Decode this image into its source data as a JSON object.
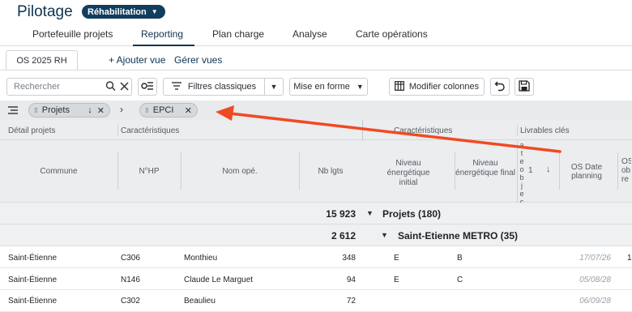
{
  "header": {
    "title": "Pilotage",
    "badge": "Réhabilitation",
    "tabs": [
      "Portefeuille projets",
      "Reporting",
      "Plan charge",
      "Analyse",
      "Carte opérations"
    ],
    "active_tab": "Reporting"
  },
  "views": {
    "current": "OS 2025 RH",
    "add_view": "+ Ajouter vue",
    "manage_views": "Gérer vues"
  },
  "toolbar": {
    "search_placeholder": "Rechercher",
    "filters_label": "Filtres classiques",
    "format_label": "Mise en forme",
    "modify_columns_label": "Modifier colonnes"
  },
  "grouping": {
    "chips": [
      "Projets",
      "EPCI"
    ]
  },
  "table": {
    "group_headers": {
      "detail": "Détail projets",
      "caracteristiques1": "Caractéristiques",
      "caracteristiques2": "Caractéristiques",
      "livrables": "Livrables clés"
    },
    "columns": {
      "commune": "Commune",
      "nhp": "N°HP",
      "nom": "Nom opé.",
      "nb_lgts": "Nb lgts",
      "niveau_initial": "Niveau énergétique initial",
      "niveau_final": "Niveau énergétique final",
      "vertical": "a t e o b j e c",
      "sort_num": "1",
      "os_date": "OS Date planning",
      "os_ob": "OS ob re"
    },
    "group_rows": [
      {
        "total": "15 923",
        "label": "Projets (180)"
      },
      {
        "total": "2 612",
        "label": "Saint-Etienne METRO (35)"
      }
    ],
    "rows": [
      {
        "commune": "Saint-Étienne",
        "nhp": "C306",
        "nom": "Monthieu",
        "nb": "348",
        "ni": "E",
        "nf": "B",
        "date": "17/07/26",
        "extra": "1"
      },
      {
        "commune": "Saint-Étienne",
        "nhp": "N146",
        "nom": "Claude Le Marguet",
        "nb": "94",
        "ni": "E",
        "nf": "C",
        "date": "05/08/28",
        "extra": ""
      },
      {
        "commune": "Saint-Étienne",
        "nhp": "C302",
        "nom": "Beaulieu",
        "nb": "72",
        "ni": "",
        "nf": "",
        "date": "06/09/28",
        "extra": ""
      }
    ]
  },
  "colors": {
    "brand": "#0e3350",
    "annotation_arrow": "#f04a23"
  }
}
